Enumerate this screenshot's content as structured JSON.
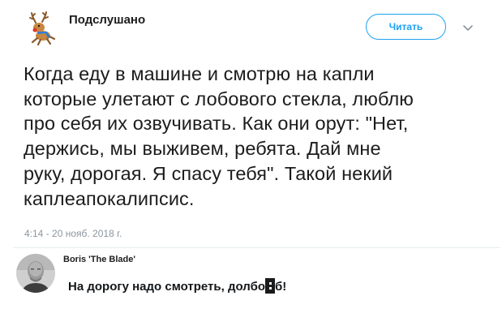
{
  "tweet": {
    "author": {
      "name": "Подслушано",
      "avatar_icon": "reindeer-logo-icon"
    },
    "follow_label": "Читать",
    "menu_icon": "chevron-down-icon",
    "text": "Когда еду в машине и смотрю на капли\nкоторые улетают с лобового стекла, люблю\nпро себя их озвучивать. Как они орут: \"Нет,\nдержись, мы выживем, ребята. Дай мне\nруку, дорогая. Я спасу тебя\". Такой некий\nкаплеапокалипсис.",
    "timestamp": "4:14 - 20 нояб. 2018 г."
  },
  "reply": {
    "author": "Boris 'The Blade'",
    "avatar_icon": "user-photo-avatar",
    "text_before": "На дорогу надо смотреть, долбо",
    "text_after": "б!",
    "censor_icon": "censor-block-icon"
  },
  "colors": {
    "accent": "#1da1f2",
    "text": "#1c1c1c",
    "muted": "#8c959d",
    "divider": "#e6ecf0"
  }
}
